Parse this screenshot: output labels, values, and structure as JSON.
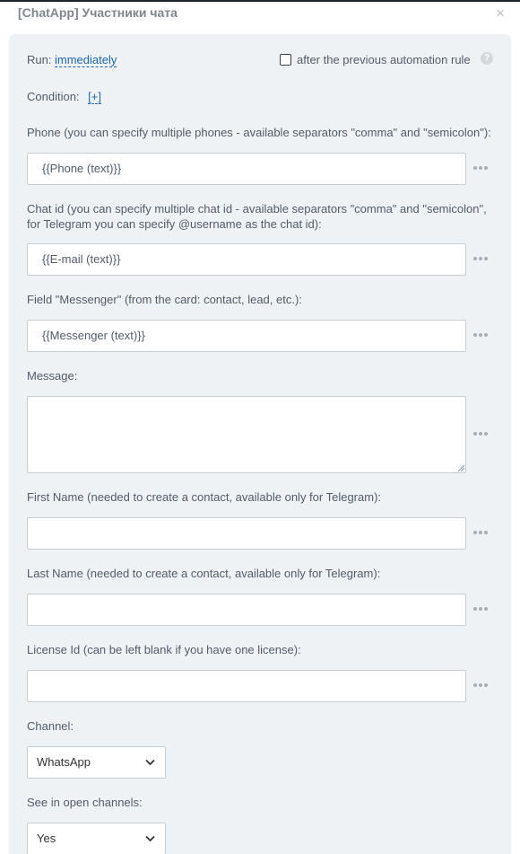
{
  "window": {
    "title": "[ChatApp] Участники чата",
    "close_symbol": "×"
  },
  "run": {
    "label": "Run:",
    "value": "immediately",
    "checkbox_label": "after the previous automation rule",
    "checkbox_checked": false,
    "help_symbol": "?"
  },
  "condition": {
    "label": "Condition:",
    "add_link": "[+]"
  },
  "fields": {
    "phone": {
      "label": "Phone (you can specify multiple phones - available separators \"comma\" and \"semicolon\"):",
      "value": "{{Phone (text)}}"
    },
    "chat_id": {
      "label_line1": "Chat id (you can specify multiple chat id - available separators \"comma\" and \"semicolon\",",
      "label_line2": "for Telegram you can specify @username as the chat id):",
      "value": "{{E-mail (text)}}"
    },
    "messenger": {
      "label": "Field \"Messenger\" (from the card: contact, lead, etc.):",
      "value": "{{Messenger (text)}}"
    },
    "message": {
      "label": "Message:",
      "value": ""
    },
    "first_name": {
      "label": "First Name (needed to create a contact, available only for Telegram):",
      "value": ""
    },
    "last_name": {
      "label": "Last Name (needed to create a contact, available only for Telegram):",
      "value": ""
    },
    "license_id": {
      "label": "License Id (can be left blank if you have one license):",
      "value": ""
    },
    "channel": {
      "label": "Channel:",
      "selected": "WhatsApp"
    },
    "open_channels": {
      "label": "See in open channels:",
      "selected": "Yes"
    }
  },
  "colors": {
    "link": "#2067b0",
    "panel_bg": "#eef2f4",
    "border": "#c6cdd3"
  }
}
